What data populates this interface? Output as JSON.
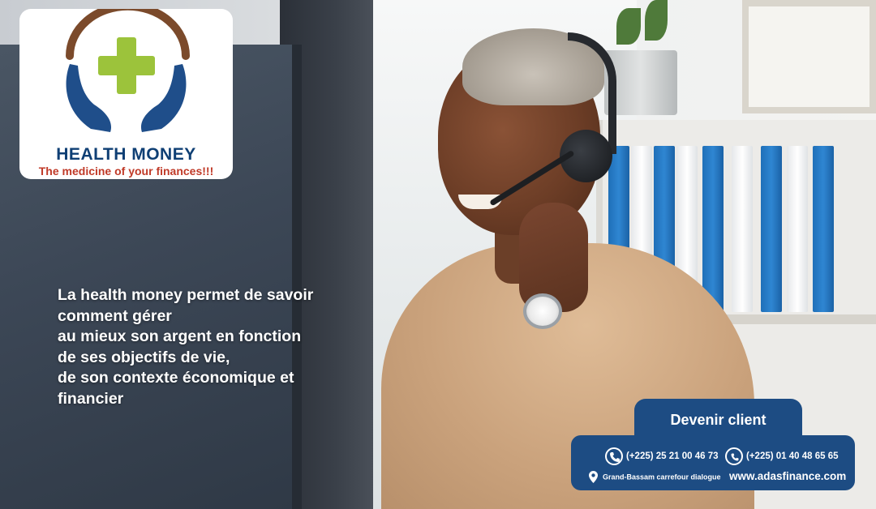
{
  "brand": {
    "name": "HEALTH MONEY",
    "tagline": "The medicine of your finances!!!",
    "colors": {
      "navy": "#0f3f74",
      "green": "#9cc33b",
      "brown": "#7b4a2b",
      "red": "#c03a28",
      "panel": "#1d4c83"
    }
  },
  "pitch": {
    "lines": [
      "La health money permet de savoir",
      "comment gérer",
      "au mieux son argent en fonction",
      "de ses objectifs de vie,",
      "de son contexte économique et",
      "financier"
    ]
  },
  "cta": {
    "label": "Devenir client",
    "phone_icon": "phone-icon",
    "whatsapp_icon": "whatsapp-icon",
    "location_icon": "map-pin-icon",
    "phone1": "(+225) 25  21 00 46 73",
    "phone2": "(+225) 01 40 48 65 65",
    "address": "Grand-Bassam carrefour dialogue",
    "website": "www.adasfinance.com"
  }
}
